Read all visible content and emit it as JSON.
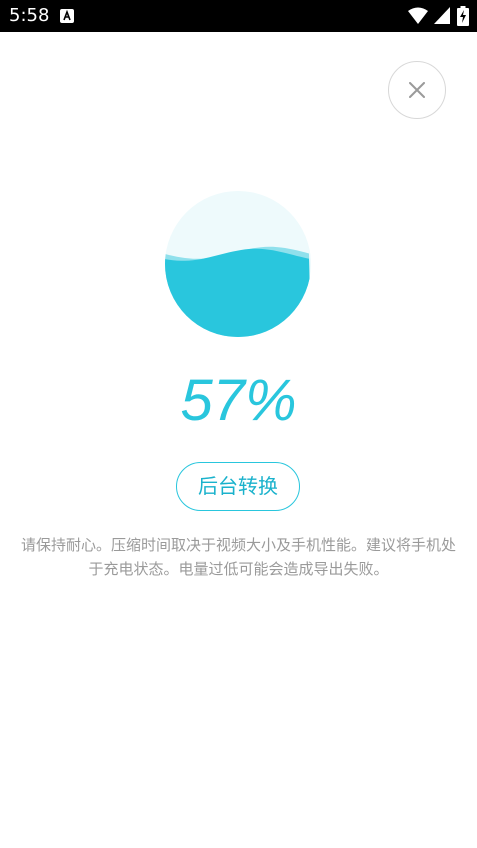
{
  "status_bar": {
    "time": "5:58",
    "icons": [
      "notification-a-icon",
      "wifi-icon",
      "signal-icon",
      "battery-charging-icon"
    ]
  },
  "close_button": {
    "icon": "close-icon"
  },
  "progress": {
    "percent": 57,
    "label": "57%"
  },
  "actions": {
    "background_button_label": "后台转换"
  },
  "notice": {
    "text": "请保持耐心。压缩时间取决于视频大小及手机性能。建议将手机处于充电状态。电量过低可能会造成导出失败。"
  },
  "colors": {
    "accent": "#29c6dd",
    "orb_background": "#eefafc",
    "wave_light": "#8fe0ec",
    "text_gray": "#9a9a9a"
  }
}
